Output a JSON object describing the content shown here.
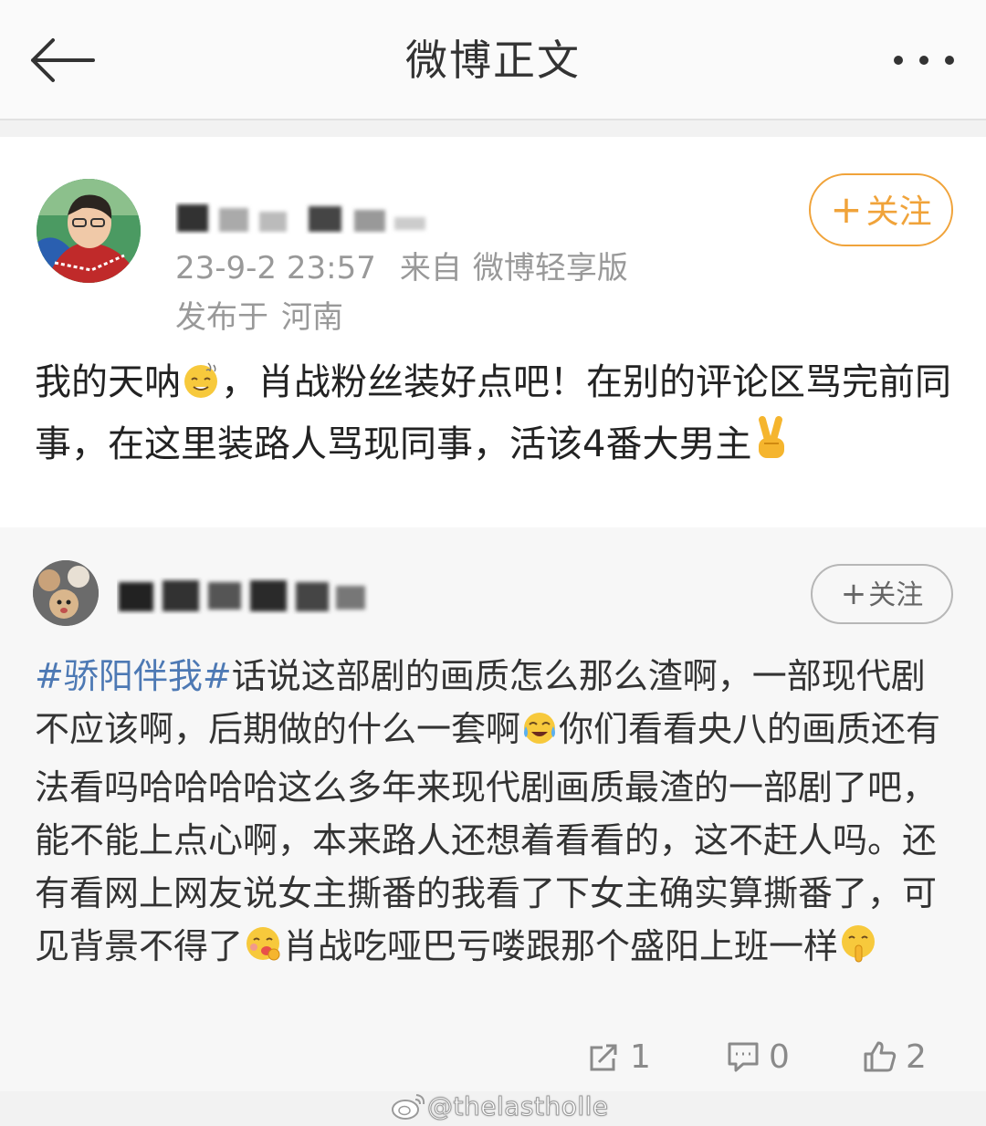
{
  "navbar": {
    "title": "微博正文"
  },
  "post": {
    "meta": {
      "time": "23-9-2 23:57",
      "source_prefix": "来自",
      "source": "微博轻享版"
    },
    "location": {
      "prefix": "发布于",
      "place": "河南"
    },
    "follow_label": "关注",
    "text": {
      "part1": "我的天呐",
      "part2": "，肖战粉丝装好点吧！在别的评论区骂完前同事，在这里装路人骂现同事，活该4番大男主"
    }
  },
  "repost": {
    "follow_label": "关注",
    "topic": "#骄阳伴我#",
    "text": {
      "part1": "话说这部剧的画质怎么那么渣啊，一部现代剧不应该啊，后期做的什么一套啊",
      "part2": "你们看看央八的画质还有法看吗哈哈哈哈这么多年来现代剧画质最渣的一部剧了吧，能不能上点心啊，本来路人还想着看看的，这不赶人吗。还有看网上网友说女主撕番的我看了下女主确实算撕番了，可见背景不得了",
      "part3": "肖战吃哑巴亏喽跟那个盛阳上班一样"
    }
  },
  "actions": {
    "reposts": "1",
    "comments": "0",
    "likes": "2"
  },
  "watermark": {
    "text": "@thelastholle"
  },
  "colors": {
    "accent_orange": "#f0a33a",
    "topic_blue": "#4d79b4",
    "meta_grey": "#999999"
  },
  "icons": [
    "back-arrow-icon",
    "more-dots-icon",
    "repost-icon",
    "comment-icon",
    "like-icon",
    "weibo-logo-icon"
  ]
}
